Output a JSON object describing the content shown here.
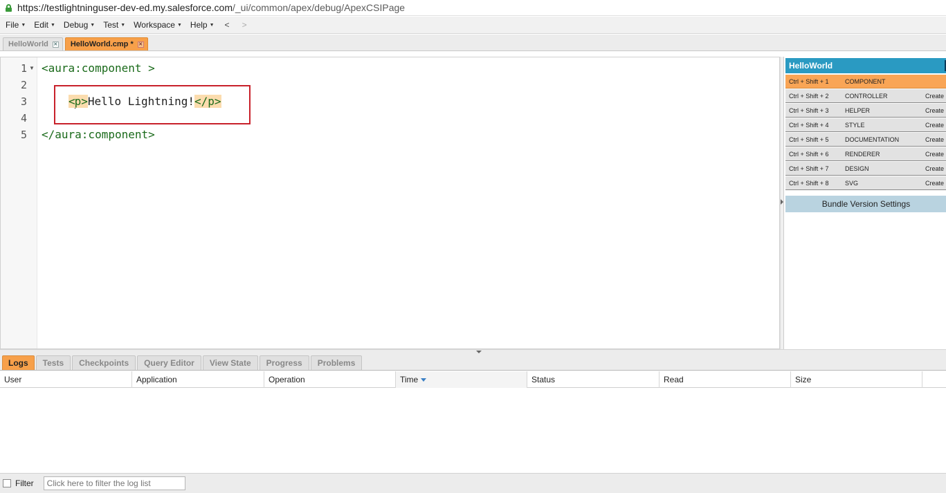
{
  "browser": {
    "url_host": "https://testlightninguser-dev-ed.my.salesforce.com",
    "url_path": "/_ui/common/apex/debug/ApexCSIPage"
  },
  "menu": {
    "items": [
      "File",
      "Edit",
      "Debug",
      "Test",
      "Workspace",
      "Help"
    ],
    "back": "<",
    "forward": ">"
  },
  "file_tabs": [
    {
      "label": "HelloWorld",
      "active": false
    },
    {
      "label": "HelloWorld.cmp *",
      "active": true
    }
  ],
  "editor": {
    "line_numbers": [
      "1",
      "2",
      "3",
      "4",
      "5"
    ],
    "line1": "<aura:component >",
    "line3_open_lt": "<",
    "line3_open_rest": "p>",
    "line3_text": "Hello Lightning!",
    "line3_close": "</p>",
    "line5": "</aura:component>"
  },
  "bundle": {
    "title": "HelloWorld",
    "items": [
      {
        "shortcut": "Ctrl + Shift + 1",
        "name": "COMPONENT",
        "action": "",
        "active": true
      },
      {
        "shortcut": "Ctrl + Shift + 2",
        "name": "CONTROLLER",
        "action": "Create"
      },
      {
        "shortcut": "Ctrl + Shift + 3",
        "name": "HELPER",
        "action": "Create"
      },
      {
        "shortcut": "Ctrl + Shift + 4",
        "name": "STYLE",
        "action": "Create"
      },
      {
        "shortcut": "Ctrl + Shift + 5",
        "name": "DOCUMENTATION",
        "action": "Create"
      },
      {
        "shortcut": "Ctrl + Shift + 6",
        "name": "RENDERER",
        "action": "Create"
      },
      {
        "shortcut": "Ctrl + Shift + 7",
        "name": "DESIGN",
        "action": "Create"
      },
      {
        "shortcut": "Ctrl + Shift + 8",
        "name": "SVG",
        "action": "Create"
      }
    ],
    "version_settings": "Bundle Version Settings"
  },
  "panel_tabs": [
    "Logs",
    "Tests",
    "Checkpoints",
    "Query Editor",
    "View State",
    "Progress",
    "Problems"
  ],
  "log_columns": [
    "User",
    "Application",
    "Operation",
    "Time",
    "Status",
    "Read",
    "Size"
  ],
  "filter": {
    "label": "Filter",
    "placeholder": "Click here to filter the log list"
  },
  "colors": {
    "accent_orange": "#f7a04a",
    "bundle_header": "#2a9ac2",
    "highlight_box": "#c8202a"
  }
}
